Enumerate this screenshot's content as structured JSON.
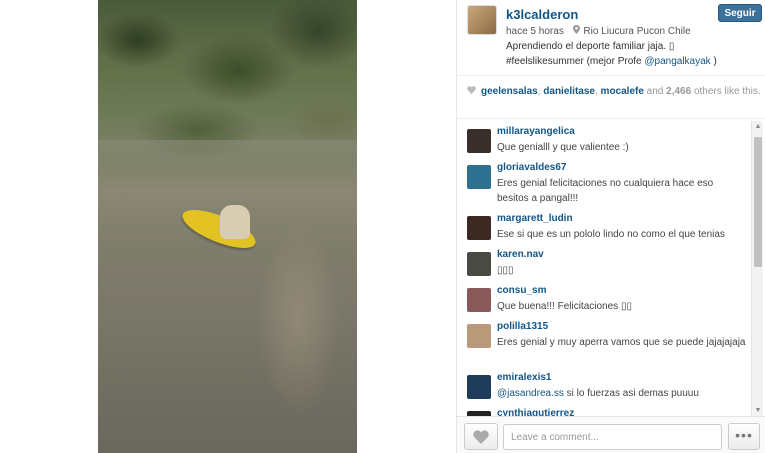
{
  "post": {
    "username": "k3lcalderon",
    "follow_label": "Seguir",
    "time_ago": "hace 5 horas",
    "location": "Rio Liucura Pucon Chile",
    "caption_line1": "Aprendiendo el deporte familiar jaja. ▯",
    "caption_line2_prefix": "#feelslikesummer (mejor Profe ",
    "caption_mention": "@pangalkayak",
    "caption_line2_suffix": " )"
  },
  "likes": {
    "likers": [
      "geelensalas",
      "danielitase",
      "mocalefe"
    ],
    "sep": ", ",
    "and_text": " and ",
    "count": "2,466",
    "rest": " others like this."
  },
  "comments": [
    {
      "user": "millarayangelica",
      "text": "Que genialll y que valientee :)",
      "avatar_color": "#3a2f2a"
    },
    {
      "user": "gloriavaldes67",
      "text": "Eres genial felicitaciones no cualquiera hace eso besitos a pangal!!!",
      "avatar_color": "#2f6f8f"
    },
    {
      "user": "margarett_ludin",
      "text": "Ese si que es un pololo lindo no como el que tenias",
      "avatar_color": "#3b2a22"
    },
    {
      "user": "karen.nav",
      "text": "▯▯▯",
      "avatar_color": "#4a4a44"
    },
    {
      "user": "consu_sm",
      "text": "Que buena!!! Felicitaciones ▯▯",
      "avatar_color": "#8a5a5a"
    },
    {
      "user": "polilla1315",
      "text": "Eres genial y muy aperra vamos que se puede jajajajaja",
      "avatar_color": "#b89a7a"
    },
    {
      "user": "emiralexis1",
      "text_mention": "@jasandrea.ss",
      "text": " si lo fuerzas asi demas puuuu",
      "avatar_color": "#1f3b5a"
    },
    {
      "user": "cynthiagutierrez",
      "text": "",
      "avatar_color": "#222"
    }
  ],
  "footer": {
    "comment_placeholder": "Leave a comment...",
    "more_label": "•••"
  },
  "icons": {
    "heart": "heart-icon",
    "location": "location-pin-icon",
    "more": "more-options-icon"
  },
  "colors": {
    "link_blue": "#125688",
    "follow_button": "#3f729b",
    "kayak_yellow": "#e3c223"
  }
}
